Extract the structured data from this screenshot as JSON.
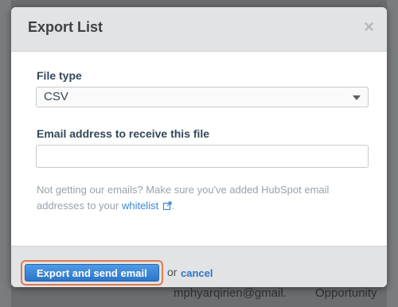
{
  "modal": {
    "title": "Export List",
    "close_glyph": "×",
    "file_type_label": "File type",
    "file_type_value": "CSV",
    "email_label": "Email address to receive this file",
    "email_value": "",
    "help_text": "Not getting our emails? Make sure you've added HubSpot email addresses to your ",
    "whitelist_link": "whitelist",
    "help_end": ".",
    "submit_label": "Export and send email",
    "or_text": "or",
    "cancel_label": "cancel"
  },
  "background": {
    "email_partial": "mphyarqirien@gmail.",
    "status_partial": "Opportunity"
  },
  "colors": {
    "primary": "#2d75c8",
    "link": "#3a86d1",
    "highlight": "#e07a4f"
  }
}
